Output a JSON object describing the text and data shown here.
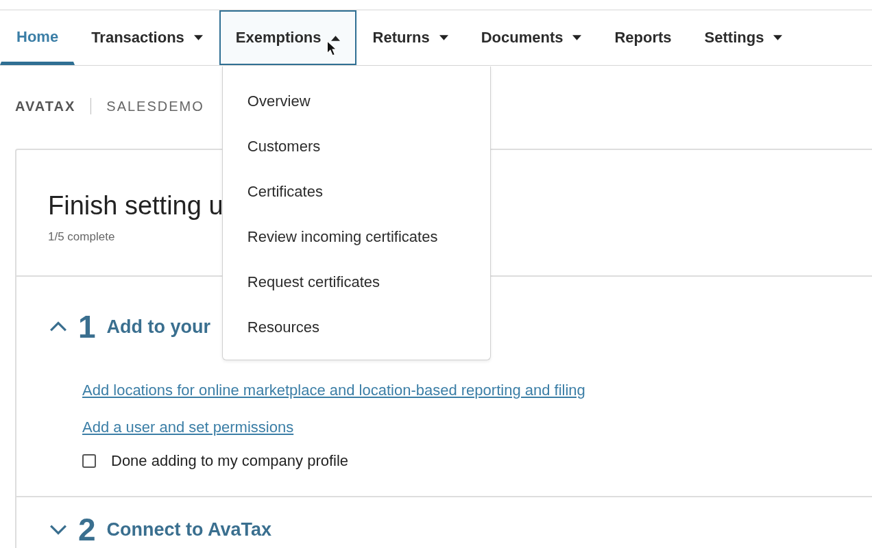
{
  "nav": [
    {
      "label": "Home",
      "selected": true,
      "has_menu": false,
      "expanded": false
    },
    {
      "label": "Transactions",
      "selected": false,
      "has_menu": true,
      "expanded": false
    },
    {
      "label": "Exemptions",
      "selected": false,
      "has_menu": true,
      "expanded": true,
      "menu": [
        "Overview",
        "Customers",
        "Certificates",
        "Review incoming certificates",
        "Request certificates",
        "Resources"
      ]
    },
    {
      "label": "Returns",
      "selected": false,
      "has_menu": true,
      "expanded": false
    },
    {
      "label": "Documents",
      "selected": false,
      "has_menu": true,
      "expanded": false
    },
    {
      "label": "Reports",
      "selected": false,
      "has_menu": false,
      "expanded": false
    },
    {
      "label": "Settings",
      "selected": false,
      "has_menu": true,
      "expanded": false
    }
  ],
  "breadcrumb": {
    "product": "AVATAX",
    "company": "SALESDEMO"
  },
  "card": {
    "title": "Finish setting u",
    "progress": "1/5 complete",
    "steps": [
      {
        "number": "1",
        "title": "Add to your",
        "expanded": true,
        "links": [
          "Add locations for online marketplace and location-based reporting and filing",
          "Add a user and set permissions"
        ],
        "checkbox": {
          "label": "Done adding to my company profile",
          "checked": false
        }
      },
      {
        "number": "2",
        "title": "Connect to AvaTax",
        "expanded": false
      }
    ]
  }
}
